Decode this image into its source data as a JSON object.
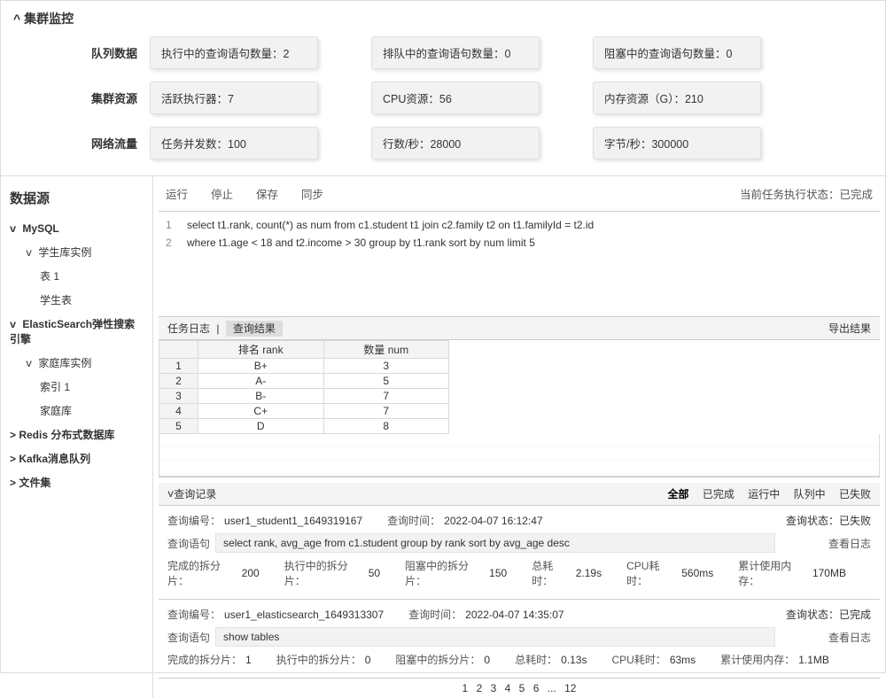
{
  "cluster": {
    "title": "集群监控",
    "rows": [
      {
        "label": "队列数据",
        "metrics": [
          {
            "label": "执行中的查询语句数量：",
            "value": "2"
          },
          {
            "label": "排队中的查询语句数量：",
            "value": "0"
          },
          {
            "label": "阻塞中的查询语句数量：",
            "value": "0"
          }
        ]
      },
      {
        "label": "集群资源",
        "metrics": [
          {
            "label": "活跃执行器：",
            "value": "7"
          },
          {
            "label": "CPU资源：",
            "value": "56"
          },
          {
            "label": "内存资源（G）：",
            "value": "210"
          }
        ]
      },
      {
        "label": "网络流量",
        "metrics": [
          {
            "label": "任务并发数：",
            "value": "100"
          },
          {
            "label": "行数/秒：",
            "value": "28000"
          },
          {
            "label": "字节/秒：",
            "value": "300000"
          }
        ]
      }
    ]
  },
  "sidebar": {
    "title": "数据源",
    "nodes": [
      {
        "type": "lv0",
        "open": true,
        "label": "MySQL"
      },
      {
        "type": "lv1",
        "open": true,
        "label": "学生库实例"
      },
      {
        "type": "lv2",
        "label": "表 1"
      },
      {
        "type": "lv2",
        "label": "学生表"
      },
      {
        "type": "lv0",
        "open": true,
        "label": "ElasticSearch弹性搜索引擎"
      },
      {
        "type": "lv1",
        "open": true,
        "label": "家庭库实例"
      },
      {
        "type": "lv2",
        "label": "索引 1"
      },
      {
        "type": "lv2",
        "label": "家庭库"
      },
      {
        "type": "lv0",
        "open": false,
        "label": "Redis 分布式数据库"
      },
      {
        "type": "lv0",
        "open": false,
        "label": "Kafka消息队列"
      },
      {
        "type": "lv0",
        "open": false,
        "label": "文件集"
      }
    ]
  },
  "toolbar": {
    "run": "运行",
    "stop": "停止",
    "save": "保存",
    "sync": "同步",
    "status_prefix": "当前任务执行状态：",
    "status_value": "已完成"
  },
  "editor": {
    "lines": [
      "select t1.rank, count(*) as num from c1.student t1 join c2.family t2 on t1.familyId = t2.id",
      "where t1.age < 18 and t2.income > 30 group by t1.rank sort by num limit 5"
    ]
  },
  "result_tabs": {
    "log": "任务日志",
    "result": "查询结果",
    "export": "导出结果"
  },
  "result_table": {
    "headers": [
      "",
      "排名 rank",
      "数量 num"
    ],
    "rows": [
      [
        "1",
        "B+",
        "3"
      ],
      [
        "2",
        "A-",
        "5"
      ],
      [
        "3",
        "B-",
        "7"
      ],
      [
        "4",
        "C+",
        "7"
      ],
      [
        "5",
        "D",
        "8"
      ]
    ]
  },
  "history": {
    "title": "查询记录",
    "filters": [
      "全部",
      "已完成",
      "运行中",
      "队列中",
      "已失败"
    ],
    "status_label": "查询状态：",
    "id_label": "查询编号：",
    "time_label": "查询时间：",
    "sql_label": "查询语句",
    "viewlog": "查看日志",
    "m_done": "完成的拆分片：",
    "m_running": "执行中的拆分片：",
    "m_blocked": "阻塞中的拆分片：",
    "m_total": "总耗时：",
    "m_cpu": "CPU耗时：",
    "m_mem": "累计使用内存：",
    "items": [
      {
        "id": "user1_student1_1649319167",
        "time": "2022-04-07 16:12:47",
        "status": "已失败",
        "sql": "select rank, avg_age from c1.student group by rank sort by avg_age desc",
        "done": "200",
        "running": "50",
        "blocked": "150",
        "total": "2.19s",
        "cpu": "560ms",
        "mem": "170MB"
      },
      {
        "id": "user1_elasticsearch_1649313307",
        "time": "2022-04-07 14:35:07",
        "status": "已完成",
        "sql": "show tables",
        "done": "1",
        "running": "0",
        "blocked": "0",
        "total": "0.13s",
        "cpu": "63ms",
        "mem": "1.1MB"
      }
    ],
    "pages": [
      "1",
      "2",
      "3",
      "4",
      "5",
      "6",
      "...",
      "12"
    ]
  }
}
